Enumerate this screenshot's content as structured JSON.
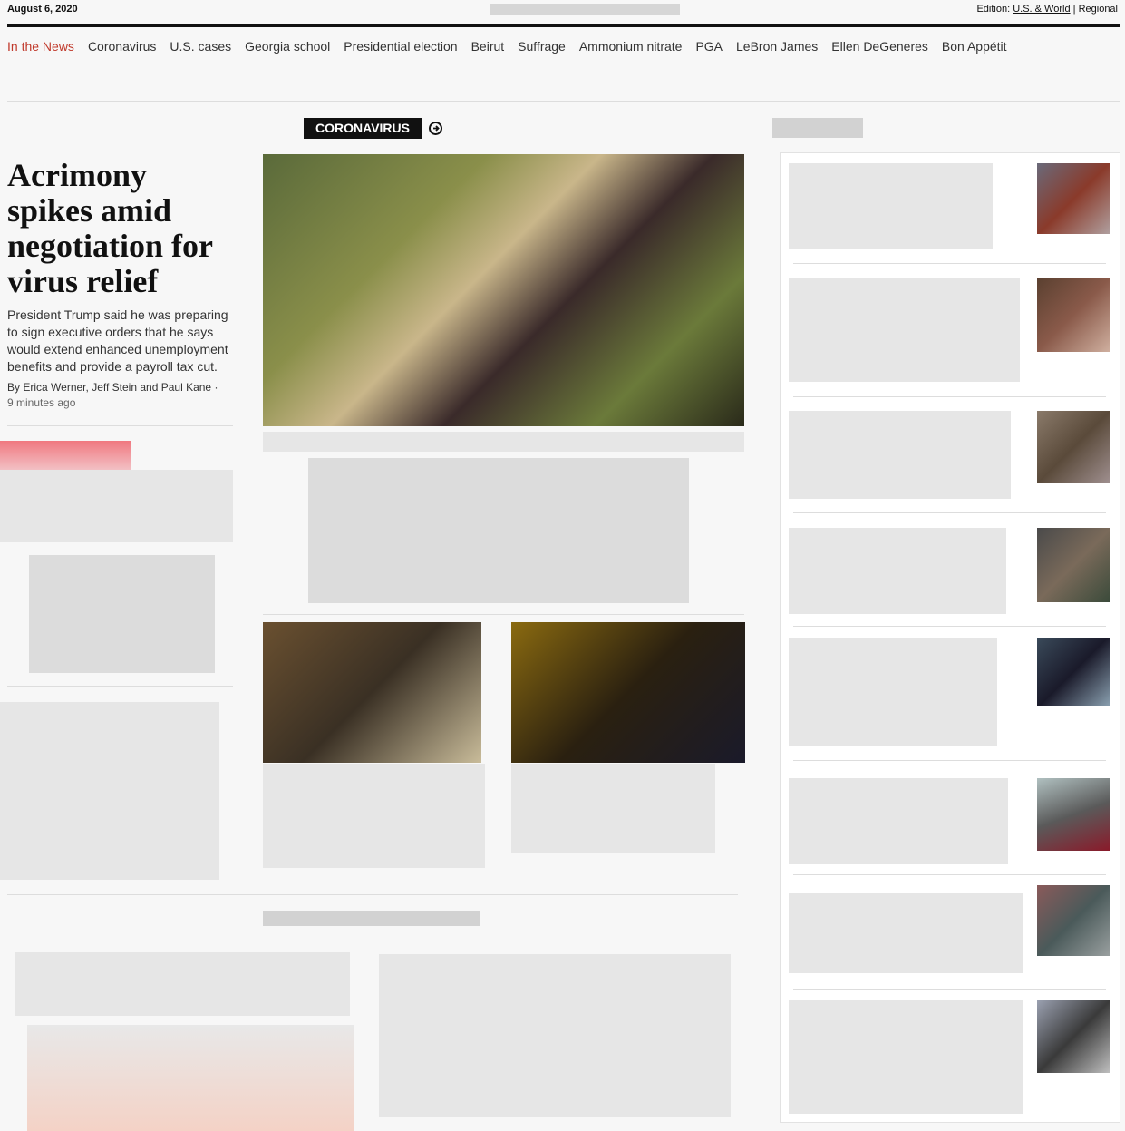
{
  "header": {
    "date": "August 6, 2020",
    "edition_label": "Edition:",
    "edition_us_world": "U.S. & World",
    "edition_sep": "|",
    "edition_regional": "Regional"
  },
  "nav": {
    "items": [
      {
        "label": "In the News"
      },
      {
        "label": "Coronavirus"
      },
      {
        "label": "U.S. cases"
      },
      {
        "label": "Georgia school"
      },
      {
        "label": "Presidential election"
      },
      {
        "label": "Beirut"
      },
      {
        "label": "Suffrage"
      },
      {
        "label": "Ammonium nitrate"
      },
      {
        "label": "PGA"
      },
      {
        "label": "LeBron James"
      },
      {
        "label": "Ellen DeGeneres"
      },
      {
        "label": "Bon Appétit"
      }
    ],
    "active_color": "#c0392b"
  },
  "section": {
    "label": "CORONAVIRUS",
    "arrow_icon": "arrow-circle-right-icon"
  },
  "lead_story": {
    "headline": "Acrimony spikes amid negotiation for virus relief",
    "summary": "President Trump said he was preparing to sign executive orders that he says would extend enhanced unemployment benefits and provide a payroll tax cut.",
    "byline_prefix": "By",
    "author_1": "Erica Werner",
    "sep_1": ",",
    "author_2": "Jeff Stein",
    "sep_2": "and",
    "author_3": "Paul Kane",
    "time": "9 minutes ago"
  }
}
